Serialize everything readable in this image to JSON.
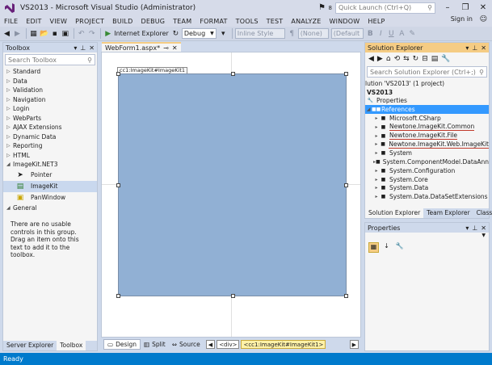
{
  "window": {
    "title": "VS2013 - Microsoft Visual Studio (Administrator)",
    "quick_launch_placeholder": "Quick Launch (Ctrl+Q)",
    "notification_count": "8"
  },
  "menu": [
    "FILE",
    "EDIT",
    "VIEW",
    "PROJECT",
    "BUILD",
    "DEBUG",
    "TEAM",
    "FORMAT",
    "TOOLS",
    "TEST",
    "ANALYZE",
    "WINDOW",
    "HELP"
  ],
  "signin_label": "Sign in",
  "toolbar": {
    "browser_label": "Internet Explorer",
    "config_value": "Debug",
    "style_dropdown": "Inline Style",
    "none_dropdown": "(None)",
    "default_dropdown": "(Default",
    "bold": "B",
    "italic": "I",
    "underline": "U",
    "font_color": "A"
  },
  "toolbox": {
    "title": "Toolbox",
    "search_placeholder": "Search Toolbox",
    "categories": [
      "Standard",
      "Data",
      "Validation",
      "Navigation",
      "Login",
      "WebParts",
      "AJAX Extensions",
      "Dynamic Data",
      "Reporting",
      "HTML"
    ],
    "expanded_category": "ImageKit.NET3",
    "items": [
      "Pointer",
      "ImageKit",
      "PanWindow"
    ],
    "general_category": "General",
    "empty_message": "There are no usable controls in this group. Drag an item onto this text to add it to the toolbox.",
    "tabs": [
      "Server Explorer",
      "Toolbox"
    ]
  },
  "document": {
    "tab_label": "WebForm1.aspx*",
    "control_label": "cc1:ImageKit#ImageKit1",
    "views": [
      "Design",
      "Split",
      "Source"
    ],
    "breadcrumb": [
      "<div>",
      "<cc1:ImageKit#ImageKit1>"
    ]
  },
  "solution_explorer": {
    "title": "Solution Explorer",
    "search_placeholder": "Search Solution Explorer (Ctrl+;)",
    "solution_row": "lution 'VS2013' (1 project)",
    "project": "VS2013",
    "properties_node": "Properties",
    "references_node": "References",
    "references": [
      "Microsoft.CSharp",
      "Newtone.ImageKit.Common",
      "Newtone.ImageKit.File",
      "Newtone.ImageKit.Web.ImageKit",
      "System",
      "System.ComponentModel.DataAnno",
      "System.Configuration",
      "System.Core",
      "System.Data",
      "System.Data.DataSetExtensions"
    ],
    "tabs": [
      "Solution Explorer",
      "Team Explorer",
      "Class View"
    ]
  },
  "properties_panel": {
    "title": "Properties"
  },
  "status": {
    "text": "Ready"
  },
  "colors": {
    "accent": "#007acc",
    "panel_title": "#4d6082",
    "active_tab": "#f5cc84",
    "imagekit_fill": "#91b0d4",
    "selection": "#3399ff",
    "highlight_underline": "#c0392b"
  }
}
